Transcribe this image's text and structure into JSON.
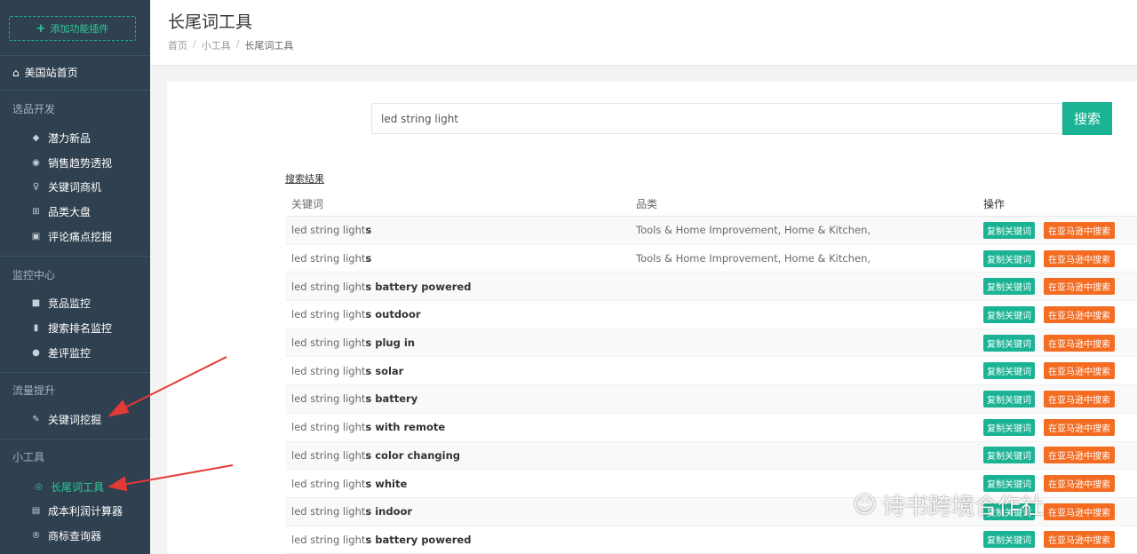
{
  "sidebar": {
    "add_plugin_label": "添加功能插件",
    "home_label": "美国站首页",
    "sections": [
      {
        "title": "选品开发",
        "items": [
          "潜力新品",
          "销售趋势透视",
          "关键词商机",
          "品类大盘",
          "评论痛点挖掘"
        ]
      },
      {
        "title": "监控中心",
        "items": [
          "竞品监控",
          "搜索排名监控",
          "差评监控"
        ]
      },
      {
        "title": "流量提升",
        "items": [
          "关键词挖掘"
        ]
      },
      {
        "title": "小工具",
        "items": [
          "长尾词工具",
          "成本利润计算器",
          "商标查询器"
        ]
      }
    ]
  },
  "header": {
    "title": "长尾词工具",
    "breadcrumb": [
      "首页",
      "小工具",
      "长尾词工具"
    ]
  },
  "search": {
    "value": "led string light",
    "button_label": "搜索"
  },
  "results_label": "搜索结果",
  "table": {
    "headers": [
      "关键词",
      "品类",
      "操作"
    ],
    "copy_label": "复制关键词",
    "amazon_label": "在亚马逊中搜索",
    "rows": [
      {
        "base": "led string light",
        "suffix": "s",
        "category": "Tools & Home Improvement, Home & Kitchen,"
      },
      {
        "base": "led string light",
        "suffix": "s",
        "category": "Tools & Home Improvement, Home & Kitchen,"
      },
      {
        "base": "led string light",
        "suffix": "s battery powered",
        "category": ""
      },
      {
        "base": "led string light",
        "suffix": "s outdoor",
        "category": ""
      },
      {
        "base": "led string light",
        "suffix": "s plug in",
        "category": ""
      },
      {
        "base": "led string light",
        "suffix": "s solar",
        "category": ""
      },
      {
        "base": "led string light",
        "suffix": "s battery",
        "category": ""
      },
      {
        "base": "led string light",
        "suffix": "s with remote",
        "category": ""
      },
      {
        "base": "led string light",
        "suffix": "s color changing",
        "category": ""
      },
      {
        "base": "led string light",
        "suffix": "s white",
        "category": ""
      },
      {
        "base": "led string light",
        "suffix": "s indoor",
        "category": ""
      },
      {
        "base": "led string light",
        "suffix": "s battery powered",
        "category": ""
      }
    ]
  },
  "watermark": "诗书跨境合作社",
  "colors": {
    "sidebar": "#2f4050",
    "accent": "#1ab394",
    "amazon": "#f36c21",
    "arrow": "#e53935"
  }
}
